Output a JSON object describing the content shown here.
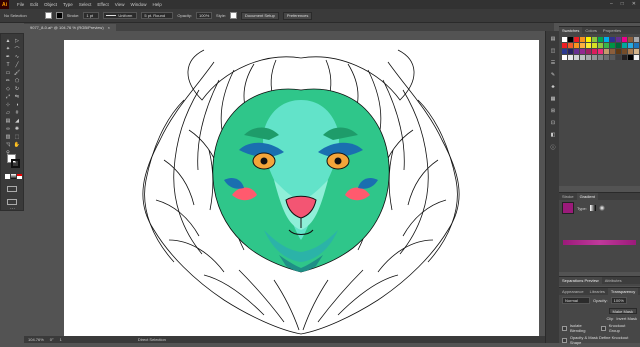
{
  "app": {
    "logo": "Ai"
  },
  "menu": [
    "File",
    "Edit",
    "Object",
    "Type",
    "Select",
    "Effect",
    "View",
    "Window",
    "Help"
  ],
  "control": {
    "selection": "No Selection",
    "stroke_label": "Stroke:",
    "stroke_value": "1 pt",
    "profile": "Uniform",
    "brush": "5 pt. Round",
    "opacity_label": "Opacity:",
    "opacity_value": "100%",
    "style_label": "Style:",
    "doc_setup": "Document Setup",
    "preferences": "Preferences"
  },
  "document": {
    "tab_title": "9077_8-0.ai* @ 104.76 % (RGB/Preview)",
    "close": "×"
  },
  "status": {
    "zoom": "104.76%",
    "rotation": "0°",
    "artboard": "1",
    "tool": "Direct Selection"
  },
  "panels": {
    "swatches_tabs": [
      "Swatches",
      "Colors",
      "Properties"
    ],
    "gradient_tabs": [
      "Stroke",
      "Gradient"
    ],
    "gradient_type_label": "Type:",
    "separations_tabs": [
      "Separations Preview",
      "Attributes"
    ],
    "transparency_tabs": [
      "Appearance",
      "Libraries",
      "Transparency"
    ],
    "blend_mode": "Normal",
    "opacity_label": "Opacity:",
    "opacity_value": "100%",
    "make_mask": "Make Mask",
    "clip": "Clip",
    "invert_mask": "Invert Mask",
    "isolate_blending": "Isolate Blending",
    "knockout_group": "Knockout Group",
    "opacity_mask": "Opacity & Mask Define Knockout Shape"
  },
  "colors": {
    "accent": "#2d8cf0",
    "face_green": "#2fc68a",
    "face_teal": "#62e3c9",
    "cheek_pink": "#ff5a6e",
    "nose_pink": "#f35573",
    "gradient_magenta": "#9b1a7a"
  },
  "swatch_colors": [
    "#ffffff",
    "#000000",
    "#ed1c24",
    "#f7941d",
    "#fff200",
    "#8dc63f",
    "#00a651",
    "#00aeef",
    "#2e3192",
    "#662d91",
    "#ec008c",
    "#8b5e3c",
    "#a7a9ac",
    "#ee1d23",
    "#f15a29",
    "#f7941e",
    "#fbb040",
    "#f9ed32",
    "#d7df23",
    "#8dc63f",
    "#39b54a",
    "#009444",
    "#006838",
    "#00a79d",
    "#27aae1",
    "#1c75bc",
    "#2b3990",
    "#262262",
    "#662d91",
    "#92278f",
    "#9e1f63",
    "#da1c5c",
    "#ee2a7b",
    "#c49a6c",
    "#8b5e3c",
    "#603913",
    "#754c29",
    "#a97c50",
    "#d2b48c",
    "#ffffff",
    "#e6e7e8",
    "#d1d3d4",
    "#bcbec0",
    "#a7a9ac",
    "#939598",
    "#808285",
    "#6d6e71",
    "#58595b",
    "#414042",
    "#231f20",
    "#000000",
    "#f1f2f2"
  ],
  "icons": [
    "selection-tool",
    "direct-selection-tool",
    "magic-wand",
    "lasso",
    "pen-tool",
    "curvature",
    "type-tool",
    "line-tool",
    "rectangle-tool",
    "paintbrush",
    "pencil",
    "shaper",
    "eraser",
    "rotate",
    "scale",
    "width",
    "free-transform",
    "shape-builder",
    "perspective",
    "mesh",
    "gradient",
    "eyedropper",
    "blend",
    "symbol-sprayer",
    "column-graph",
    "artboard-tool",
    "slice",
    "hand-tool",
    "zoom-tool"
  ]
}
